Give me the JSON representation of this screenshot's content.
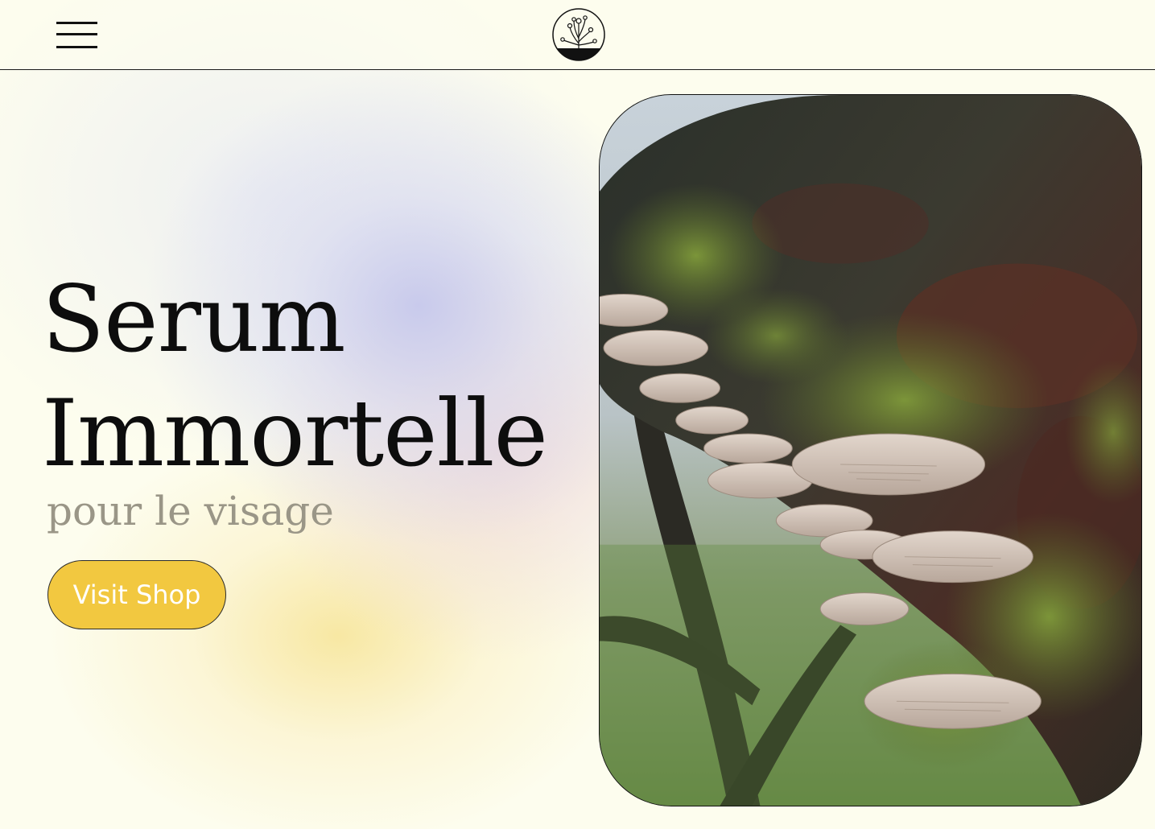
{
  "header": {
    "menu_icon": "hamburger-menu-icon",
    "logo_icon": "botanical-flowers-logo-icon"
  },
  "hero": {
    "title_line1": "Serum",
    "title_line2": "Immortelle",
    "subtitle": "pour le visage",
    "cta_label": "Visit Shop",
    "photo_description": ""
  },
  "colors": {
    "background": "#fdfdee",
    "cta": "#f2c840",
    "text": "#0d0d0d",
    "subtitle": "#9a9687"
  }
}
